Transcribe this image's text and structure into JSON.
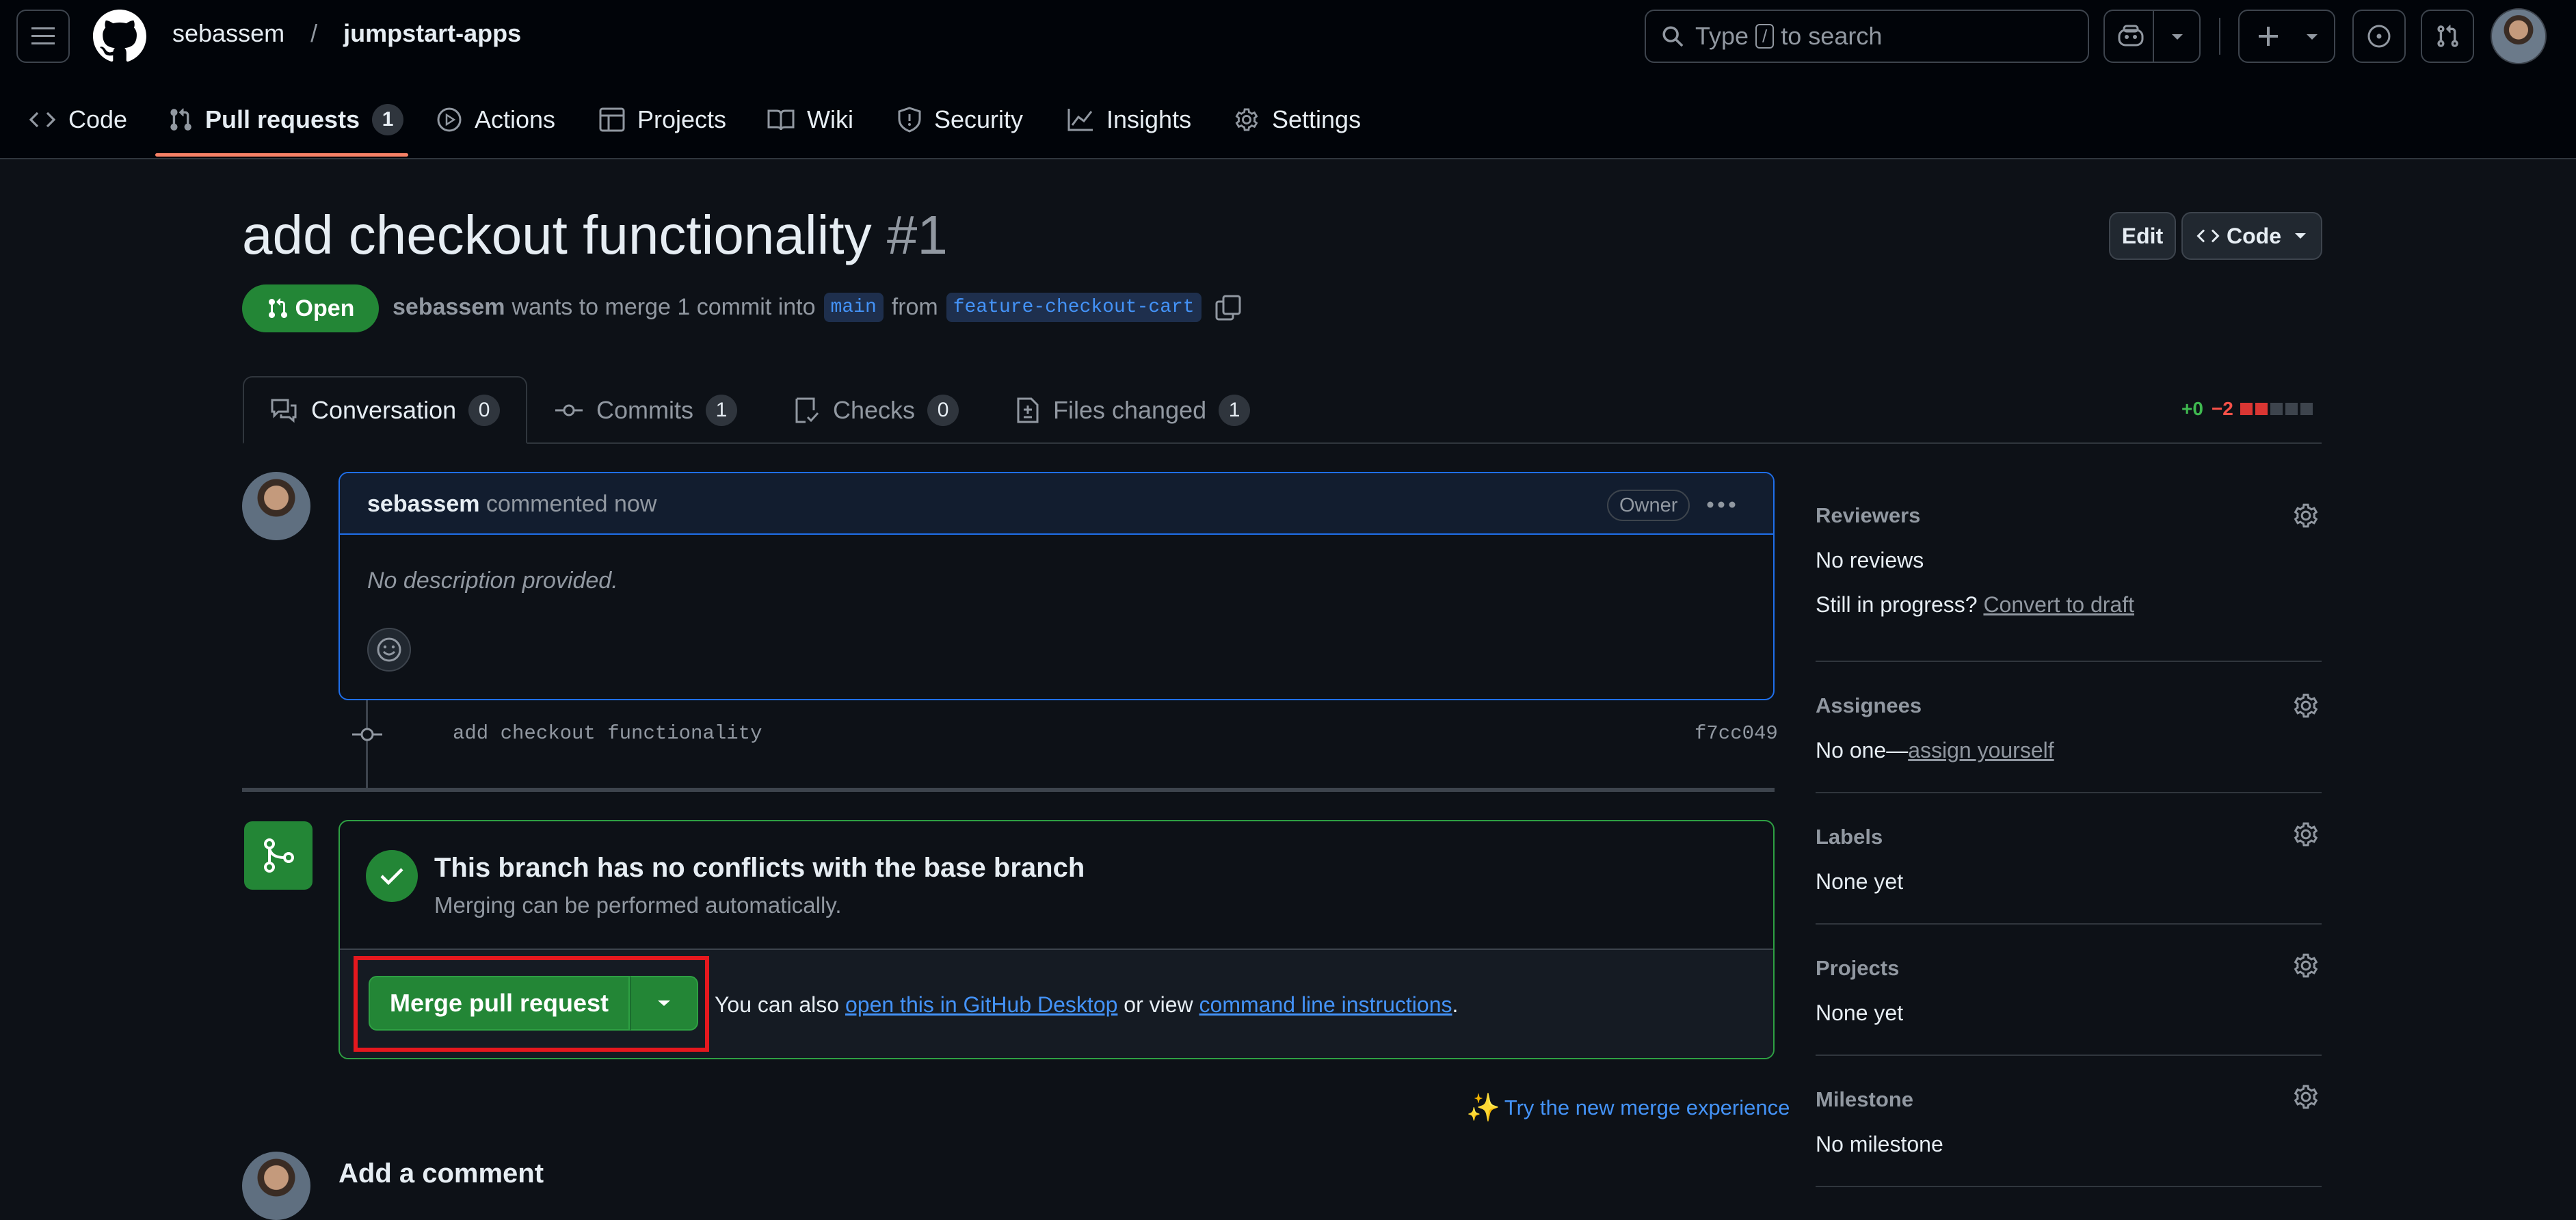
{
  "header": {
    "owner": "sebassem",
    "separator": "/",
    "repo": "jumpstart-apps",
    "search_prefix": "Type",
    "search_key": "/",
    "search_suffix": "to search"
  },
  "repo_nav": {
    "code": "Code",
    "pull_requests": "Pull requests",
    "pull_requests_count": "1",
    "actions": "Actions",
    "projects": "Projects",
    "wiki": "Wiki",
    "security": "Security",
    "insights": "Insights",
    "settings": "Settings"
  },
  "pr": {
    "title": "add checkout functionality",
    "number": "#1",
    "state": "Open",
    "author": "sebassem",
    "merge_text": "wants to merge 1 commit into",
    "base_branch": "main",
    "from_text": "from",
    "head_branch": "feature-checkout-cart",
    "edit_label": "Edit",
    "code_label": "Code"
  },
  "pr_tabs": {
    "conversation": "Conversation",
    "conversation_count": "0",
    "commits": "Commits",
    "commits_count": "1",
    "checks": "Checks",
    "checks_count": "0",
    "files_changed": "Files changed",
    "files_changed_count": "1",
    "additions": "+0",
    "deletions": "−2"
  },
  "comment": {
    "author": "sebassem",
    "action": "commented now",
    "role": "Owner",
    "body": "No description provided."
  },
  "commit": {
    "message": "add checkout functionality",
    "sha": "f7cc049"
  },
  "merge": {
    "title": "This branch has no conflicts with the base branch",
    "subtitle": "Merging can be performed automatically.",
    "button_label": "Merge pull request",
    "also_text": "You can also",
    "desktop_link": "open this in GitHub Desktop",
    "or_view": "or view",
    "cli_link": "command line instructions",
    "period": ".",
    "new_experience": "Try the new merge experience"
  },
  "add_comment": {
    "title": "Add a comment"
  },
  "sidebar": {
    "reviewers_heading": "Reviewers",
    "reviewers_value": "No reviews",
    "still_in_progress": "Still in progress?",
    "convert_to_draft": "Convert to draft",
    "assignees_heading": "Assignees",
    "assignees_value": "No one—",
    "assign_yourself": "assign yourself",
    "labels_heading": "Labels",
    "labels_value": "None yet",
    "projects_heading": "Projects",
    "projects_value": "None yet",
    "milestone_heading": "Milestone",
    "milestone_value": "No milestone"
  },
  "colors": {
    "accent_green": "#238636",
    "link_blue": "#4493f8",
    "highlight_red": "#e5181e"
  }
}
